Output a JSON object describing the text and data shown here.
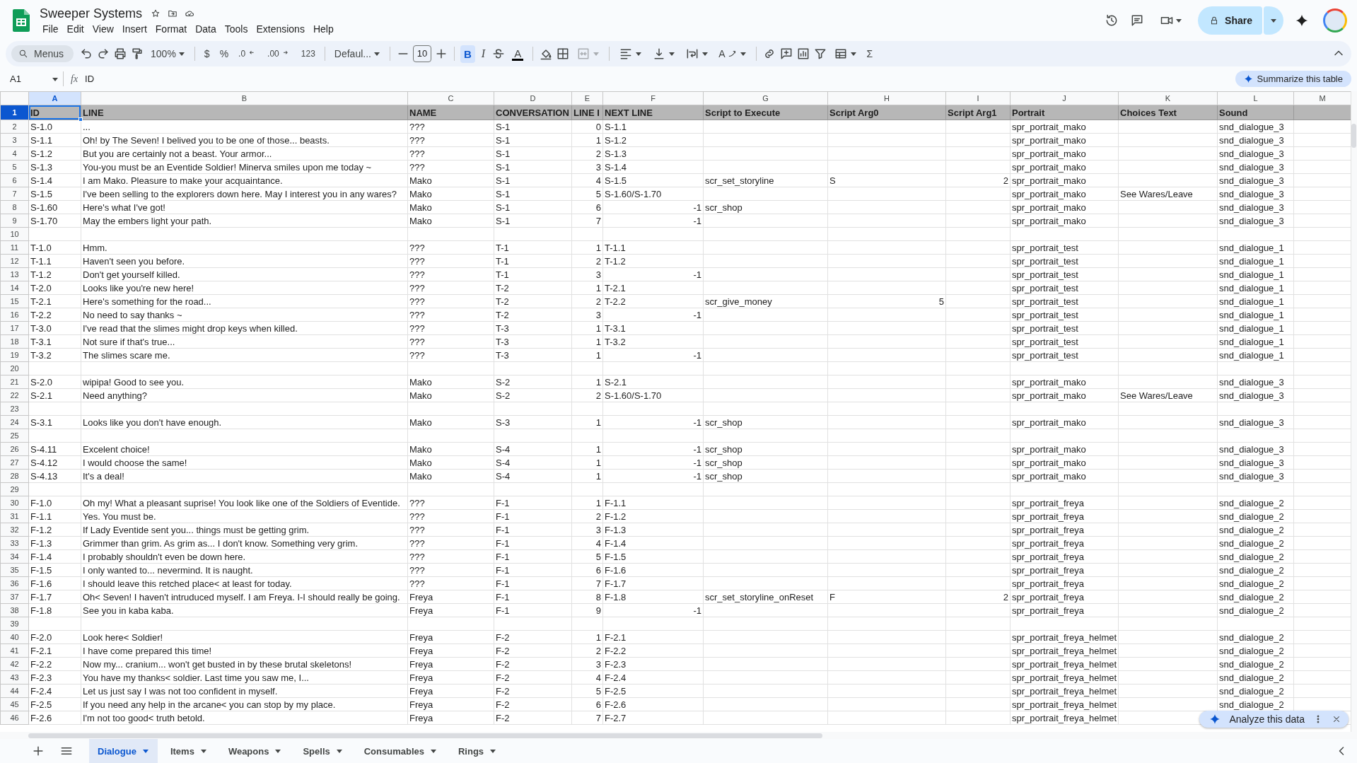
{
  "app": {
    "title": "Sweeper Systems",
    "menus": [
      "File",
      "Edit",
      "View",
      "Insert",
      "Format",
      "Data",
      "Tools",
      "Extensions",
      "Help"
    ],
    "share": "Share"
  },
  "toolbar": {
    "search": "Menus",
    "zoom": "100%",
    "currency": "$",
    "percent": "%",
    "decimal_decrease": ".0",
    "decimal_increase": ".00",
    "number_format": "123",
    "font": "Defaul...",
    "font_size": "10",
    "bold": {
      "label": "B",
      "on": true
    },
    "italic": "I",
    "text_color": "A",
    "merge": {
      "disabled": true
    },
    "rotate": "A",
    "functions": "Σ"
  },
  "formula_bar": {
    "cell": "A1",
    "fx": "fx",
    "value": "ID",
    "summarize": "Summarize this table"
  },
  "sheet": {
    "columns": [
      {
        "letter": "A",
        "selected": true
      },
      {
        "letter": "B",
        "selected": false
      },
      {
        "letter": "C",
        "selected": false
      },
      {
        "letter": "D",
        "selected": false
      },
      {
        "letter": "E",
        "selected": false
      },
      {
        "letter": "F",
        "selected": false
      },
      {
        "letter": "G",
        "selected": false
      },
      {
        "letter": "H",
        "selected": false
      },
      {
        "letter": "I",
        "selected": false
      },
      {
        "letter": "J",
        "selected": false
      },
      {
        "letter": "K",
        "selected": false
      },
      {
        "letter": "L",
        "selected": false
      },
      {
        "letter": "M",
        "selected": false
      }
    ],
    "header_row": {
      "number": "1",
      "selected": true,
      "cells": {
        "A": "ID",
        "B": "LINE",
        "C": "NAME",
        "D": "CONVERSATION",
        "E": "LINE I",
        "F": "NEXT LINE",
        "G": "Script to Execute",
        "H": "Script Arg0",
        "I": "Script Arg1",
        "J": "Portrait",
        "K": "Choices Text",
        "L": "Sound"
      }
    },
    "rows": [
      {
        "number": "2",
        "selected": false,
        "cells": {
          "A": "S-1.0",
          "B": "...",
          "C": "???",
          "D": "S-1",
          "F": "S-1.1",
          "J": "spr_portrait_mako",
          "L": "snd_dialogue_3"
        },
        "numbers": {
          "E": "0"
        }
      },
      {
        "number": "3",
        "selected": false,
        "cells": {
          "A": "S-1.1",
          "B": "Oh! by The Seven! I belived you to be one of those... beasts.",
          "C": "???",
          "D": "S-1",
          "F": "S-1.2",
          "J": "spr_portrait_mako",
          "L": "snd_dialogue_3"
        },
        "numbers": {
          "E": "1"
        }
      },
      {
        "number": "4",
        "selected": false,
        "cells": {
          "A": "S-1.2",
          "B": "But you are certainly not a beast. Your armor...",
          "C": "???",
          "D": "S-1",
          "F": "S-1.3",
          "J": "spr_portrait_mako",
          "L": "snd_dialogue_3"
        },
        "numbers": {
          "E": "2"
        }
      },
      {
        "number": "5",
        "selected": false,
        "cells": {
          "A": "S-1.3",
          "B": "You-you must be an Eventide Soldier! Minerva smiles upon me today ~",
          "C": "???",
          "D": "S-1",
          "F": "S-1.4",
          "J": "spr_portrait_mako",
          "L": "snd_dialogue_3"
        },
        "numbers": {
          "E": "3"
        }
      },
      {
        "number": "6",
        "selected": false,
        "cells": {
          "A": "S-1.4",
          "B": "I am Mako. Pleasure to make your acquaintance.",
          "C": "Mako",
          "D": "S-1",
          "F": "S-1.5",
          "G": "scr_set_storyline",
          "H": "S",
          "J": "spr_portrait_mako",
          "L": "snd_dialogue_3"
        },
        "numbers": {
          "E": "4",
          "I": "2"
        }
      },
      {
        "number": "7",
        "selected": false,
        "cells": {
          "A": "S-1.5",
          "B": "I've been selling to the explorers down here. May I interest you in any wares?",
          "C": "Mako",
          "D": "S-1",
          "F": "S-1.60/S-1.70",
          "J": "spr_portrait_mako",
          "K": "See Wares/Leave",
          "L": "snd_dialogue_3"
        },
        "numbers": {
          "E": "5"
        }
      },
      {
        "number": "8",
        "selected": false,
        "cells": {
          "A": "S-1.60",
          "B": "Here's what I've got!",
          "C": "Mako",
          "D": "S-1",
          "G": "scr_shop",
          "J": "spr_portrait_mako",
          "L": "snd_dialogue_3"
        },
        "numbers": {
          "E": "6",
          "F": "-1"
        }
      },
      {
        "number": "9",
        "selected": false,
        "cells": {
          "A": "S-1.70",
          "B": "May the embers light your path.",
          "C": "Mako",
          "D": "S-1",
          "J": "spr_portrait_mako",
          "L": "snd_dialogue_3"
        },
        "numbers": {
          "E": "7",
          "F": "-1"
        }
      },
      {
        "number": "10",
        "selected": false
      },
      {
        "number": "11",
        "selected": false,
        "cells": {
          "A": "T-1.0",
          "B": "Hmm.",
          "C": "???",
          "D": "T-1",
          "F": "T-1.1",
          "J": "spr_portrait_test",
          "L": "snd_dialogue_1"
        },
        "numbers": {
          "E": "1"
        }
      },
      {
        "number": "12",
        "selected": false,
        "cells": {
          "A": "T-1.1",
          "B": "Haven't seen you before.",
          "C": "???",
          "D": "T-1",
          "F": "T-1.2",
          "J": "spr_portrait_test",
          "L": "snd_dialogue_1"
        },
        "numbers": {
          "E": "2"
        }
      },
      {
        "number": "13",
        "selected": false,
        "cells": {
          "A": "T-1.2",
          "B": "Don't get yourself killed.",
          "C": "???",
          "D": "T-1",
          "J": "spr_portrait_test",
          "L": "snd_dialogue_1"
        },
        "numbers": {
          "E": "3",
          "F": "-1"
        }
      },
      {
        "number": "14",
        "selected": false,
        "cells": {
          "A": "T-2.0",
          "B": "Looks like you're new here!",
          "C": "???",
          "D": "T-2",
          "F": "T-2.1",
          "J": "spr_portrait_test",
          "L": "snd_dialogue_1"
        },
        "numbers": {
          "E": "1"
        }
      },
      {
        "number": "15",
        "selected": false,
        "cells": {
          "A": "T-2.1",
          "B": "Here's something for the road...",
          "C": "???",
          "D": "T-2",
          "F": "T-2.2",
          "G": "scr_give_money",
          "J": "spr_portrait_test",
          "L": "snd_dialogue_1"
        },
        "numbers": {
          "E": "2",
          "H": "5"
        }
      },
      {
        "number": "16",
        "selected": false,
        "cells": {
          "A": "T-2.2",
          "B": "No need to say thanks ~",
          "C": "???",
          "D": "T-2",
          "J": "spr_portrait_test",
          "L": "snd_dialogue_1"
        },
        "numbers": {
          "E": "3",
          "F": "-1"
        }
      },
      {
        "number": "17",
        "selected": false,
        "cells": {
          "A": "T-3.0",
          "B": "I've read that the slimes might drop keys when killed.",
          "C": "???",
          "D": "T-3",
          "F": "T-3.1",
          "J": "spr_portrait_test",
          "L": "snd_dialogue_1"
        },
        "numbers": {
          "E": "1"
        }
      },
      {
        "number": "18",
        "selected": false,
        "cells": {
          "A": "T-3.1",
          "B": "Not sure if that's true...",
          "C": "???",
          "D": "T-3",
          "F": "T-3.2",
          "J": "spr_portrait_test",
          "L": "snd_dialogue_1"
        },
        "numbers": {
          "E": "1"
        }
      },
      {
        "number": "19",
        "selected": false,
        "cells": {
          "A": "T-3.2",
          "B": "The slimes scare me.",
          "C": "???",
          "D": "T-3",
          "J": "spr_portrait_test",
          "L": "snd_dialogue_1"
        },
        "numbers": {
          "E": "1",
          "F": "-1"
        }
      },
      {
        "number": "20",
        "selected": false
      },
      {
        "number": "21",
        "selected": false,
        "cells": {
          "A": "S-2.0",
          "B": "wipipa! Good to see you.",
          "C": "Mako",
          "D": "S-2",
          "F": "S-2.1",
          "J": "spr_portrait_mako",
          "L": "snd_dialogue_3"
        },
        "numbers": {
          "E": "1"
        }
      },
      {
        "number": "22",
        "selected": false,
        "cells": {
          "A": "S-2.1",
          "B": "Need anything?",
          "C": "Mako",
          "D": "S-2",
          "F": "S-1.60/S-1.70",
          "J": "spr_portrait_mako",
          "K": "See Wares/Leave",
          "L": "snd_dialogue_3"
        },
        "numbers": {
          "E": "2"
        }
      },
      {
        "number": "23",
        "selected": false
      },
      {
        "number": "24",
        "selected": false,
        "cells": {
          "A": "S-3.1",
          "B": "Looks like you don't have enough.",
          "C": "Mako",
          "D": "S-3",
          "G": "scr_shop",
          "J": "spr_portrait_mako",
          "L": "snd_dialogue_3"
        },
        "numbers": {
          "E": "1",
          "F": "-1"
        }
      },
      {
        "number": "25",
        "selected": false
      },
      {
        "number": "26",
        "selected": false,
        "cells": {
          "A": "S-4.11",
          "B": "Excelent choice!",
          "C": "Mako",
          "D": "S-4",
          "G": "scr_shop",
          "J": "spr_portrait_mako",
          "L": "snd_dialogue_3"
        },
        "numbers": {
          "E": "1",
          "F": "-1"
        }
      },
      {
        "number": "27",
        "selected": false,
        "cells": {
          "A": "S-4.12",
          "B": "I would choose the same!",
          "C": "Mako",
          "D": "S-4",
          "G": "scr_shop",
          "J": "spr_portrait_mako",
          "L": "snd_dialogue_3"
        },
        "numbers": {
          "E": "1",
          "F": "-1"
        }
      },
      {
        "number": "28",
        "selected": false,
        "cells": {
          "A": "S-4.13",
          "B": "It's a deal!",
          "C": "Mako",
          "D": "S-4",
          "G": "scr_shop",
          "J": "spr_portrait_mako",
          "L": "snd_dialogue_3"
        },
        "numbers": {
          "E": "1",
          "F": "-1"
        }
      },
      {
        "number": "29",
        "selected": false
      },
      {
        "number": "30",
        "selected": false,
        "cells": {
          "A": "F-1.0",
          "B": "Oh my! What a pleasant suprise! You look like one of the Soldiers of Eventide.",
          "C": "???",
          "D": "F-1",
          "F": "F-1.1",
          "J": "spr_portrait_freya",
          "L": "snd_dialogue_2"
        },
        "numbers": {
          "E": "1"
        }
      },
      {
        "number": "31",
        "selected": false,
        "cells": {
          "A": "F-1.1",
          "B": "Yes. You must be.",
          "C": "???",
          "D": "F-1",
          "F": "F-1.2",
          "J": "spr_portrait_freya",
          "L": "snd_dialogue_2"
        },
        "numbers": {
          "E": "2"
        }
      },
      {
        "number": "32",
        "selected": false,
        "cells": {
          "A": "F-1.2",
          "B": "If Lady Eventide sent you... things must be getting grim.",
          "C": "???",
          "D": "F-1",
          "F": "F-1.3",
          "J": "spr_portrait_freya",
          "L": "snd_dialogue_2"
        },
        "numbers": {
          "E": "3"
        }
      },
      {
        "number": "33",
        "selected": false,
        "cells": {
          "A": "F-1.3",
          "B": "Grimmer than grim. As grim as... I don't know. Something very grim.",
          "C": "???",
          "D": "F-1",
          "F": "F-1.4",
          "J": "spr_portrait_freya",
          "L": "snd_dialogue_2"
        },
        "numbers": {
          "E": "4"
        }
      },
      {
        "number": "34",
        "selected": false,
        "cells": {
          "A": "F-1.4",
          "B": "I probably shouldn't even be down here.",
          "C": "???",
          "D": "F-1",
          "F": "F-1.5",
          "J": "spr_portrait_freya",
          "L": "snd_dialogue_2"
        },
        "numbers": {
          "E": "5"
        }
      },
      {
        "number": "35",
        "selected": false,
        "cells": {
          "A": "F-1.5",
          "B": "I only wanted to... nevermind. It is naught.",
          "C": "???",
          "D": "F-1",
          "F": "F-1.6",
          "J": "spr_portrait_freya",
          "L": "snd_dialogue_2"
        },
        "numbers": {
          "E": "6"
        }
      },
      {
        "number": "36",
        "selected": false,
        "cells": {
          "A": "F-1.6",
          "B": "I should leave this retched place< at least for today.",
          "C": "???",
          "D": "F-1",
          "F": "F-1.7",
          "J": "spr_portrait_freya",
          "L": "snd_dialogue_2"
        },
        "numbers": {
          "E": "7"
        }
      },
      {
        "number": "37",
        "selected": false,
        "cells": {
          "A": "F-1.7",
          "B": "Oh< Seven! I haven't intruduced myself. I am Freya. I-I should really be going.",
          "C": "Freya",
          "D": "F-1",
          "F": "F-1.8",
          "G": "scr_set_storyline_onReset",
          "H": "F",
          "J": "spr_portrait_freya",
          "L": "snd_dialogue_2"
        },
        "numbers": {
          "E": "8",
          "I": "2"
        }
      },
      {
        "number": "38",
        "selected": false,
        "cells": {
          "A": "F-1.8",
          "B": "See you in kaba kaba.",
          "C": "Freya",
          "D": "F-1",
          "J": "spr_portrait_freya",
          "L": "snd_dialogue_2"
        },
        "numbers": {
          "E": "9",
          "F": "-1"
        }
      },
      {
        "number": "39",
        "selected": false
      },
      {
        "number": "40",
        "selected": false,
        "cells": {
          "A": "F-2.0",
          "B": "Look here< Soldier!",
          "C": "Freya",
          "D": "F-2",
          "F": "F-2.1",
          "J": "spr_portrait_freya_helmet",
          "L": "snd_dialogue_2"
        },
        "numbers": {
          "E": "1"
        }
      },
      {
        "number": "41",
        "selected": false,
        "cells": {
          "A": "F-2.1",
          "B": "I have come prepared this time!",
          "C": "Freya",
          "D": "F-2",
          "F": "F-2.2",
          "J": "spr_portrait_freya_helmet",
          "L": "snd_dialogue_2"
        },
        "numbers": {
          "E": "2"
        }
      },
      {
        "number": "42",
        "selected": false,
        "cells": {
          "A": "F-2.2",
          "B": "Now my... cranium... won't get busted in by these brutal skeletons!",
          "C": "Freya",
          "D": "F-2",
          "F": "F-2.3",
          "J": "spr_portrait_freya_helmet",
          "L": "snd_dialogue_2"
        },
        "numbers": {
          "E": "3"
        }
      },
      {
        "number": "43",
        "selected": false,
        "cells": {
          "A": "F-2.3",
          "B": "You have my thanks< soldier. Last time you saw me, I...",
          "C": "Freya",
          "D": "F-2",
          "F": "F-2.4",
          "J": "spr_portrait_freya_helmet",
          "L": "snd_dialogue_2"
        },
        "numbers": {
          "E": "4"
        }
      },
      {
        "number": "44",
        "selected": false,
        "cells": {
          "A": "F-2.4",
          "B": "Let us just say I was not too confident in myself.",
          "C": "Freya",
          "D": "F-2",
          "F": "F-2.5",
          "J": "spr_portrait_freya_helmet",
          "L": "snd_dialogue_2"
        },
        "numbers": {
          "E": "5"
        }
      },
      {
        "number": "45",
        "selected": false,
        "cells": {
          "A": "F-2.5",
          "B": "If you need any help in the arcane< you can stop by my place.",
          "C": "Freya",
          "D": "F-2",
          "F": "F-2.6",
          "J": "spr_portrait_freya_helmet",
          "L": "snd_dialogue_2"
        },
        "numbers": {
          "E": "6"
        }
      },
      {
        "number": "46",
        "selected": false,
        "cells": {
          "A": "F-2.6",
          "B": "I'm not too good< truth betold.",
          "C": "Freya",
          "D": "F-2",
          "F": "F-2.7",
          "J": "spr_portrait_freya_helmet"
        },
        "numbers": {
          "E": "7"
        }
      }
    ]
  },
  "analyze": {
    "label": "Analyze this data"
  },
  "sheet_tabs": [
    {
      "label": "Dialogue",
      "selected": true
    },
    {
      "label": "Items",
      "selected": false
    },
    {
      "label": "Weapons",
      "selected": false
    },
    {
      "label": "Spells",
      "selected": false
    },
    {
      "label": "Consumables",
      "selected": false
    },
    {
      "label": "Rings",
      "selected": false
    }
  ]
}
